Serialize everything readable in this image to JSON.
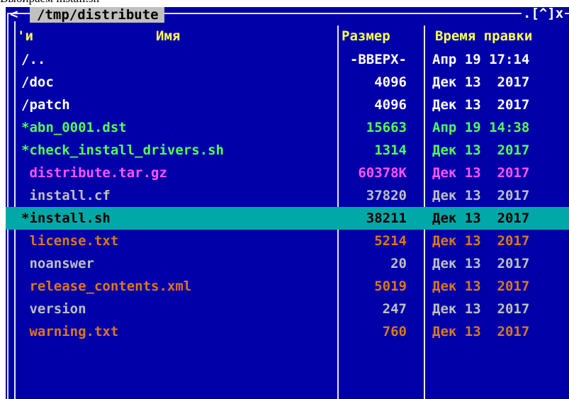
{
  "caption": "Выбираем install.sh",
  "panel": {
    "corner_arrow": "<",
    "path": "/tmp/distribute",
    "frame_controls": ".[^]x"
  },
  "columns": {
    "sort_mark": "'и",
    "name": "Имя",
    "size": "Размер",
    "modified": "Время правки"
  },
  "files": [
    {
      "name": "/..",
      "size": "-ВВЕРХ-",
      "date": "Апр 19 17:14",
      "color": "#ffffff"
    },
    {
      "name": "/doc",
      "size": "4096",
      "date": "Дек 13  2017",
      "color": "#ffffff"
    },
    {
      "name": "/patch",
      "size": "4096",
      "date": "Дек 13  2017",
      "color": "#ffffff"
    },
    {
      "name": "*abn_0001.dst",
      "size": "15663",
      "date": "Апр 19 14:38",
      "color": "#55ff55"
    },
    {
      "name": "*check_install_drivers.sh",
      "size": "1314",
      "date": "Дек 13  2017",
      "color": "#55ff55"
    },
    {
      "name": " distribute.tar.gz",
      "size": "60378K",
      "date": "Дек 13  2017",
      "color": "#ff55ff"
    },
    {
      "name": " install.cf",
      "size": "37820",
      "date": "Дек 13  2017",
      "color": "#c0c0c0"
    },
    {
      "name": "*install.sh",
      "size": "38211",
      "date": "Дек 13  2017",
      "color": "#000000",
      "selected": true
    },
    {
      "name": " license.txt",
      "size": "5214",
      "date": "Дек 13  2017",
      "color": "#d9781e"
    },
    {
      "name": " noanswer",
      "size": "20",
      "date": "Дек 13  2017",
      "color": "#c0c0c0"
    },
    {
      "name": " release_contents.xml",
      "size": "5019",
      "date": "Дек 13  2017",
      "color": "#d9781e"
    },
    {
      "name": " version",
      "size": "247",
      "date": "Дек 13  2017",
      "color": "#c0c0c0"
    },
    {
      "name": " warning.txt",
      "size": "760",
      "date": "Дек 13  2017",
      "color": "#d9781e"
    }
  ]
}
